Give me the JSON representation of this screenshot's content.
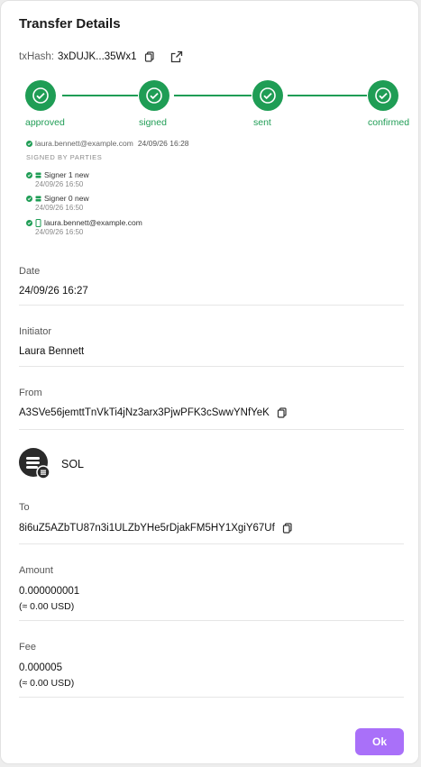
{
  "modal": {
    "title": "Transfer Details"
  },
  "txhash": {
    "label": "txHash:",
    "value": "3xDUJK...35Wx1"
  },
  "steps": [
    {
      "label": "approved"
    },
    {
      "label": "signed"
    },
    {
      "label": "sent"
    },
    {
      "label": "confirmed"
    }
  ],
  "approval": {
    "email": "laura.bennett@example.com",
    "timestamp": "24/09/26 16:28"
  },
  "signed_by": {
    "heading": "SIGNED BY PARTIES",
    "signers": [
      {
        "name": "Signer 1 new",
        "timestamp": "24/09/26 16:50",
        "icon": "server-icon"
      },
      {
        "name": "Signer 0 new",
        "timestamp": "24/09/26 16:50",
        "icon": "server-icon"
      },
      {
        "name": "laura.bennett@example.com",
        "timestamp": "24/09/26 16:50",
        "icon": "phone-icon"
      }
    ]
  },
  "fields": {
    "date": {
      "label": "Date",
      "value": "24/09/26 16:27"
    },
    "initiator": {
      "label": "Initiator",
      "value": "Laura Bennett"
    },
    "from": {
      "label": "From",
      "value": "A3SVe56jemttTnVkTi4jNz3arx3PjwPFK3cSwwYNfYeK"
    },
    "token": {
      "name": "SOL"
    },
    "to": {
      "label": "To",
      "value": "8i6uZ5AZbTU87n3i1ULZbYHe5rDjakFM5HY1XgiY67Uf"
    },
    "amount": {
      "label": "Amount",
      "value": "0.000000001",
      "usd": "(≈ 0.00 USD)"
    },
    "fee": {
      "label": "Fee",
      "value": "0.000005",
      "usd": "(≈ 0.00 USD)"
    }
  },
  "actions": {
    "ok_label": "Ok"
  },
  "colors": {
    "success": "#1f9d55",
    "primary": "#a970f9"
  }
}
